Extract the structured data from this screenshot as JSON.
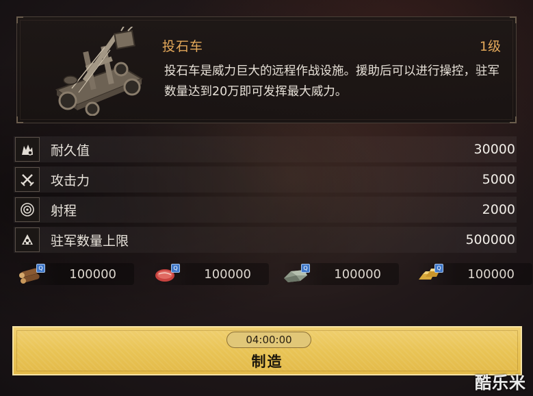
{
  "item": {
    "name": "投石车",
    "level": "1级",
    "description": "投石车是威力巨大的远程作战设施。援助后可以进行操控，驻军数量达到20万即可发挥最大威力。",
    "image_icon": "catapult-icon"
  },
  "stats": [
    {
      "label": "耐久值",
      "value": "30000",
      "icon": "durability-icon"
    },
    {
      "label": "攻击力",
      "value": "5000",
      "icon": "crossed-swords-icon"
    },
    {
      "label": "射程",
      "value": "2000",
      "icon": "target-icon"
    },
    {
      "label": "驻军数量上限",
      "value": "500000",
      "icon": "troops-icon"
    }
  ],
  "costs": [
    {
      "amount": "100000",
      "icon": "wood-icon"
    },
    {
      "amount": "100000",
      "icon": "meat-icon"
    },
    {
      "amount": "100000",
      "icon": "stone-icon"
    },
    {
      "amount": "100000",
      "icon": "gold-icon"
    }
  ],
  "build": {
    "timer": "04:00:00",
    "label": "制造"
  },
  "watermark": "酷乐米",
  "colors": {
    "title": "#e3a85a",
    "button": "#e9c456",
    "badge": "#3f77c8"
  }
}
